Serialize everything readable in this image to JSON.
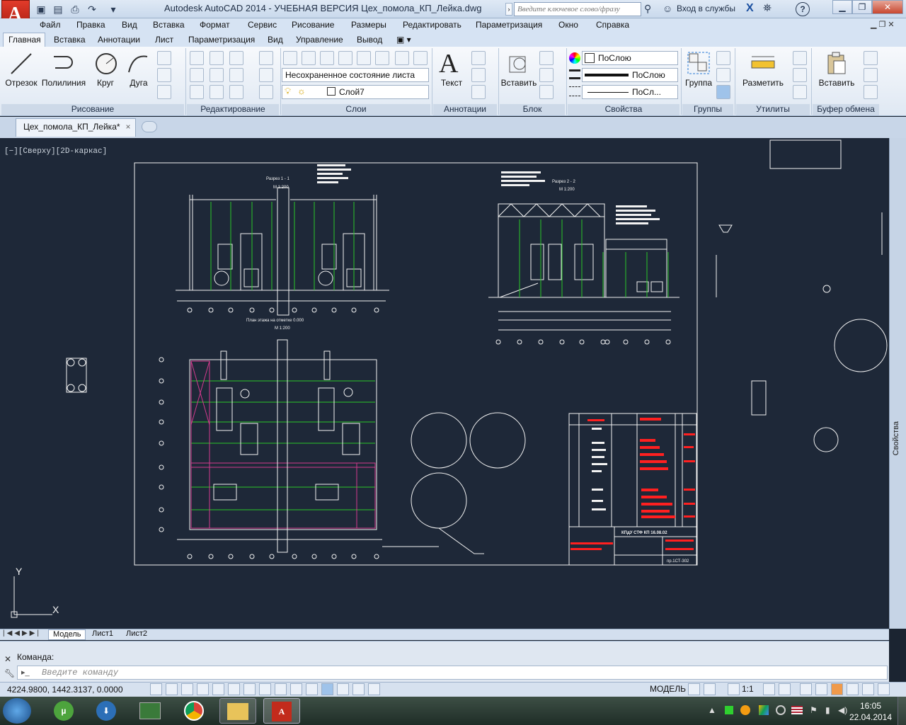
{
  "window": {
    "title": "Autodesk AutoCAD 2014 - УЧЕБНАЯ ВЕРСИЯ    Цех_помола_КП_Лейка.dwg",
    "search_placeholder": "Введите ключевое слово/фразу",
    "login_label": "Вход в службы"
  },
  "menu": [
    "Файл",
    "Правка",
    "Вид",
    "Вставка",
    "Формат",
    "Сервис",
    "Рисование",
    "Размеры",
    "Редактировать",
    "Параметризация",
    "Окно",
    "Справка"
  ],
  "ribbon_tabs": [
    "Главная",
    "Вставка",
    "Аннотации",
    "Лист",
    "Параметризация",
    "Вид",
    "Управление",
    "Вывод"
  ],
  "ribbon": {
    "draw": {
      "line": "Отрезок",
      "polyline": "Полилиния",
      "circle": "Круг",
      "arc": "Дуга",
      "panel": "Рисование"
    },
    "modify": {
      "panel": "Редактирование"
    },
    "layers": {
      "state": "Несохраненное состояние листа",
      "current": "Слой7",
      "panel": "Слои"
    },
    "annotation": {
      "text": "Текст",
      "panel": "Аннотации"
    },
    "block": {
      "insert": "Вставить",
      "panel": "Блок"
    },
    "properties": {
      "color": "ПоСлою",
      "lineweight": "ПоСлою",
      "linetype": "ПоСл...",
      "panel": "Свойства"
    },
    "groups": {
      "group": "Группа",
      "panel": "Группы"
    },
    "utilities": {
      "measure": "Разметить",
      "panel": "Утилиты"
    },
    "clipboard": {
      "paste": "Вставить",
      "panel": "Буфер обмена"
    }
  },
  "document": {
    "tab": "Цех_помола_КП_Лейка*"
  },
  "viewport": {
    "label": "[−][Сверху][2D-каркас]",
    "section1_title": "Разрез 1 - 1",
    "section1_scale": "М 1:200",
    "section2_title": "Разрез 2 - 2",
    "section2_scale": "М 1:200",
    "plan_title": "План этажа на отметке 0.000",
    "plan_scale": "М 1:200",
    "stamp_code": "пр.1СТ-302",
    "stamp_title": "КПдУ СТФ КП 16.08.02",
    "ucs_x": "X",
    "ucs_y": "Y"
  },
  "properties_palette": "Свойства",
  "layout_tabs": [
    "Модель",
    "Лист1",
    "Лист2"
  ],
  "command": {
    "label": "Команда:",
    "placeholder": "Введите команду"
  },
  "status": {
    "coords": "4224.9800, 1442.3137, 0.0000",
    "model": "МОДЕЛЬ",
    "scale": "1:1"
  },
  "taskbar": {
    "time": "16:05",
    "date": "22.04.2014"
  },
  "colors": {
    "drawing_bg": "#1e2838",
    "green": "#29c629",
    "magenta": "#d43a8e",
    "red": "#ff2020",
    "white": "#f2f2f2"
  }
}
